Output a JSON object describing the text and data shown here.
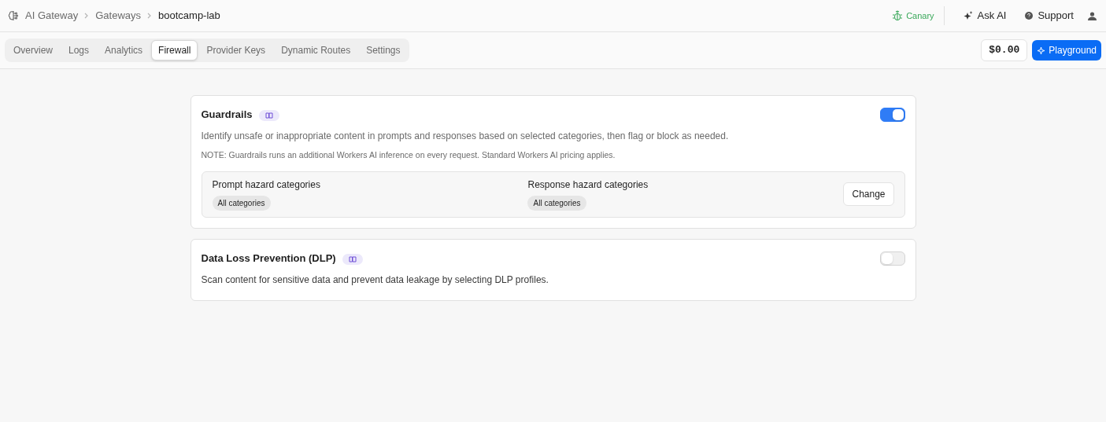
{
  "breadcrumbs": [
    {
      "label": "AI Gateway"
    },
    {
      "label": "Gateways"
    },
    {
      "label": "bootcamp-lab"
    }
  ],
  "header_actions": {
    "environment": "Canary",
    "ask_ai": "Ask AI",
    "support": "Support"
  },
  "tabs": [
    {
      "label": "Overview",
      "selected": false
    },
    {
      "label": "Logs",
      "selected": false
    },
    {
      "label": "Analytics",
      "selected": false
    },
    {
      "label": "Firewall",
      "selected": true
    },
    {
      "label": "Provider Keys",
      "selected": false
    },
    {
      "label": "Dynamic Routes",
      "selected": false
    },
    {
      "label": "Settings",
      "selected": false
    }
  ],
  "cost": "$0.00",
  "playground_button": "Playground",
  "guardrails": {
    "title": "Guardrails",
    "on": true,
    "description": "Identify unsafe or inappropriate content in prompts and responses based on selected categories, then flag or block as needed.",
    "note": "NOTE: Guardrails runs an additional Workers AI inference on every request. Standard Workers AI pricing applies.",
    "categories": [
      {
        "label": "Prompt hazard categories",
        "value": "All categories"
      },
      {
        "label": "Response hazard categories",
        "value": "All categories"
      }
    ],
    "change_button": "Change"
  },
  "dlp": {
    "title": "Data Loss Prevention (DLP)",
    "on": false,
    "description": "Scan content for sensitive data and prevent data leakage by selecting DLP profiles."
  }
}
